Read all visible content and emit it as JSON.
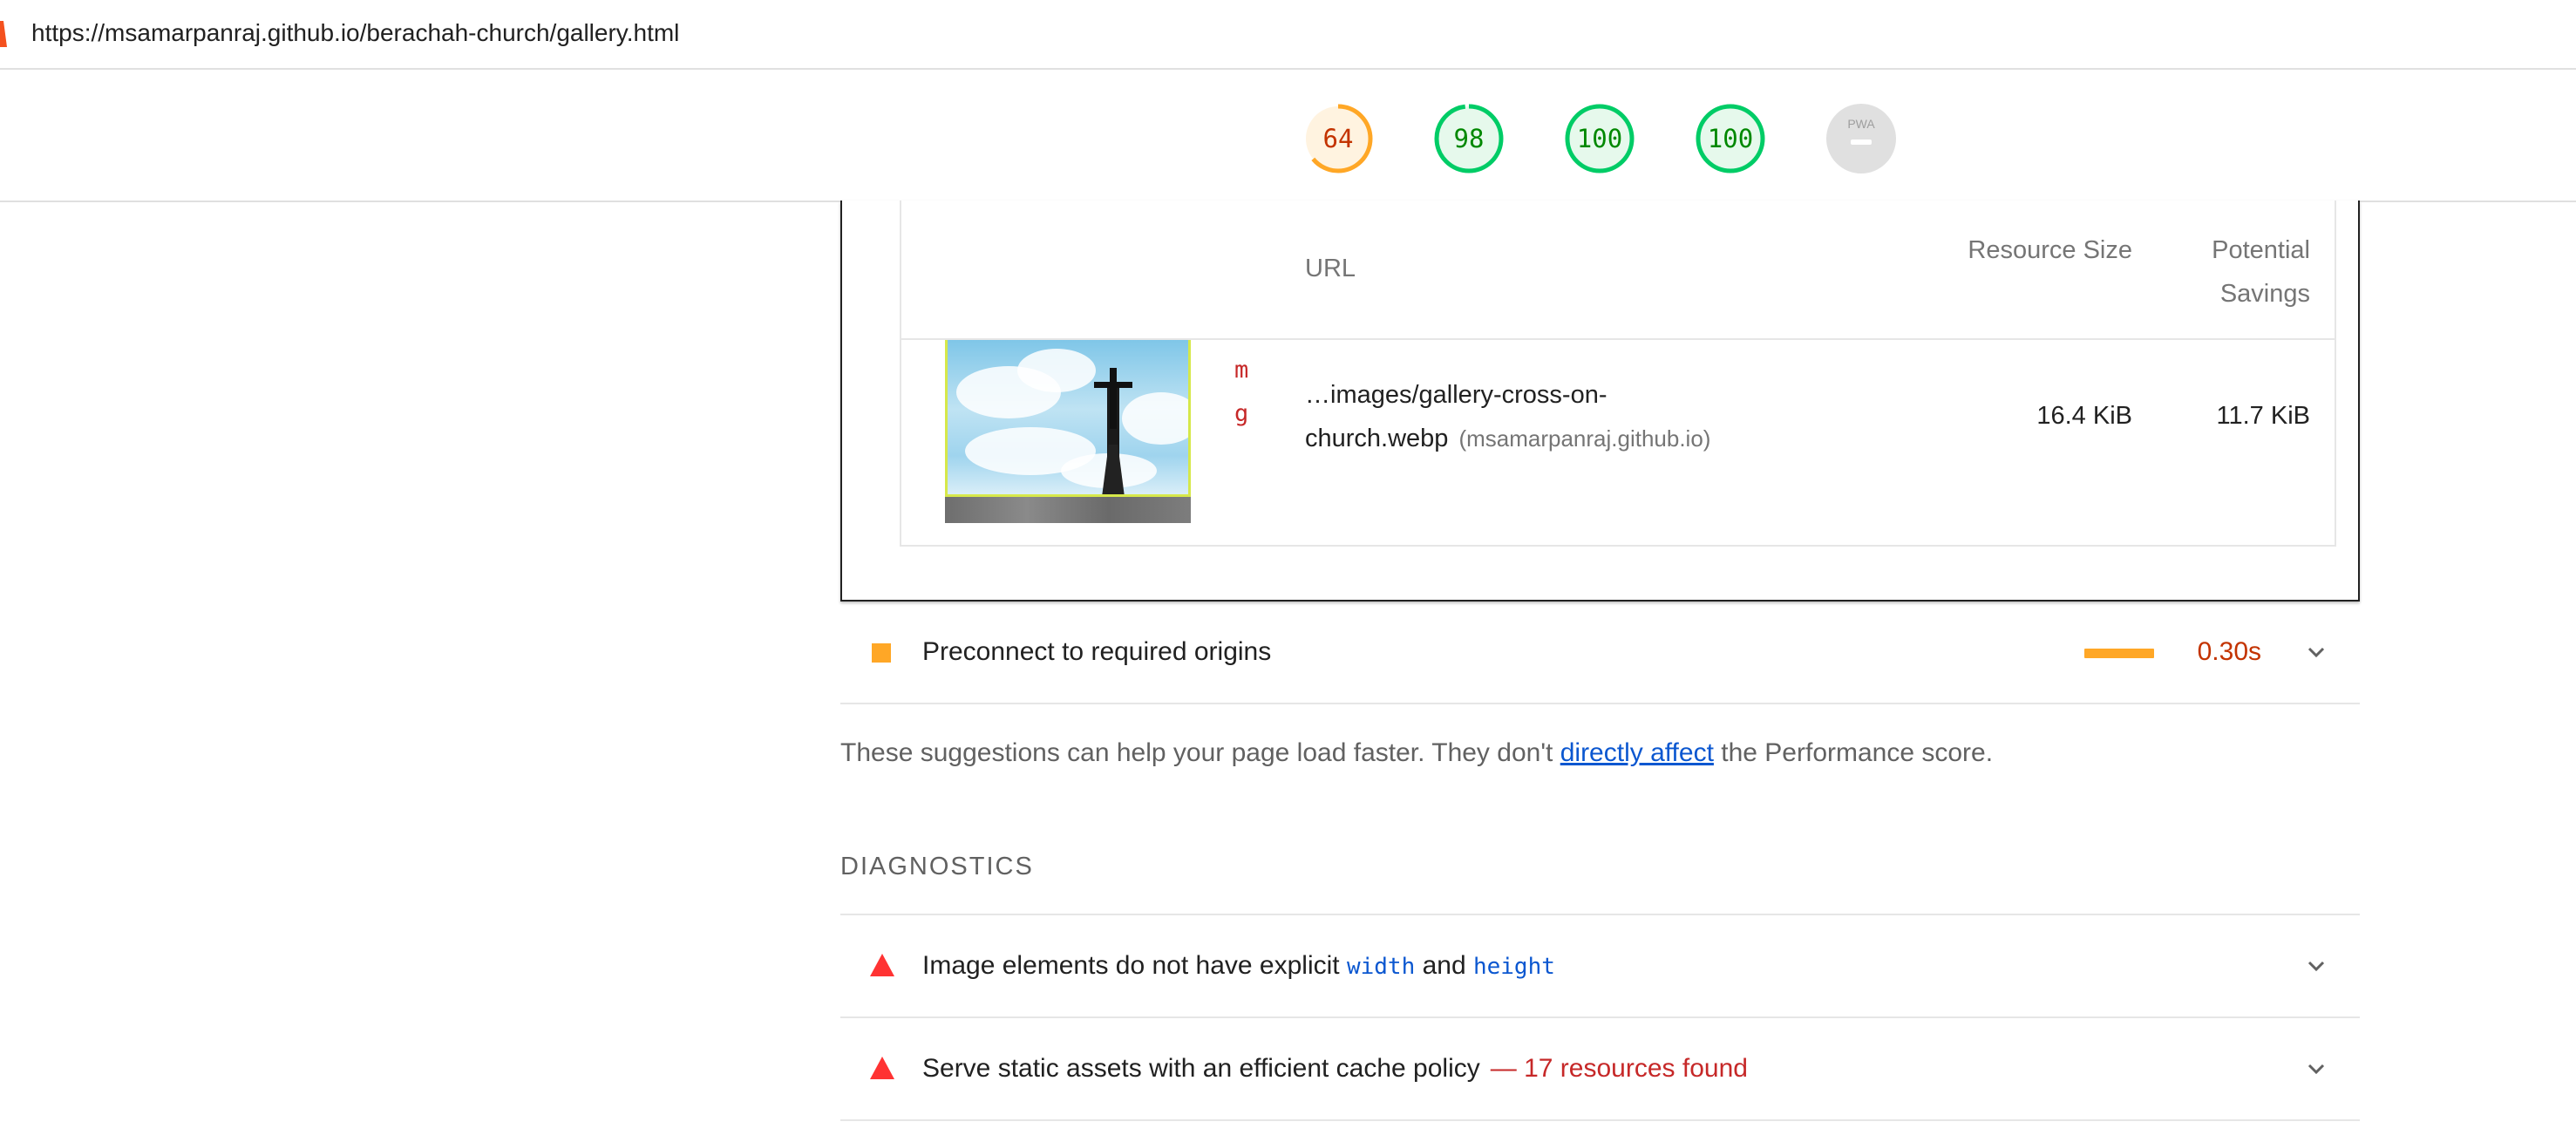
{
  "address_bar": {
    "url": "https://msamarpanraj.github.io/berachah-church/gallery.html"
  },
  "scores": [
    {
      "value": "64",
      "status": "average",
      "color": "#fa3",
      "fraction": 0.64
    },
    {
      "value": "98",
      "status": "pass",
      "color": "#0c6",
      "fraction": 0.98
    },
    {
      "value": "100",
      "status": "pass",
      "color": "#0c6",
      "fraction": 1.0
    },
    {
      "value": "100",
      "status": "pass",
      "color": "#0c6",
      "fraction": 1.0
    },
    {
      "value": "PWA",
      "status": "na",
      "color": "#cccccc",
      "fraction": 0
    }
  ],
  "details_table": {
    "headers": {
      "url": "URL",
      "resource_size": "Resource Size",
      "potential_savings": "Potential Savings"
    },
    "rows": [
      {
        "node_snippet": "mg",
        "url_path": "…images/gallery-cross-on-church.webp",
        "host": "(msamarpanraj.github.io)",
        "resource_size": "16.4 KiB",
        "potential_savings": "11.7 KiB"
      }
    ]
  },
  "opportunity": {
    "title": "Preconnect to required origins",
    "value": "0.30s",
    "icon": "orange-square-icon",
    "color": "#ffa726"
  },
  "suggestions_text": {
    "before": "These suggestions can help your page load faster. They don't ",
    "link": "directly affect",
    "after": " the Performance score."
  },
  "diagnostics": {
    "group_title": "DIAGNOSTICS",
    "items": [
      {
        "title_before": "Image elements do not have explicit ",
        "code1": "width",
        "title_mid": " and ",
        "code2": "height",
        "icon": "red-triangle-icon"
      },
      {
        "title": "Serve static assets with an efficient cache policy",
        "display_value": "— 17 resources found",
        "icon": "red-triangle-icon"
      }
    ]
  }
}
